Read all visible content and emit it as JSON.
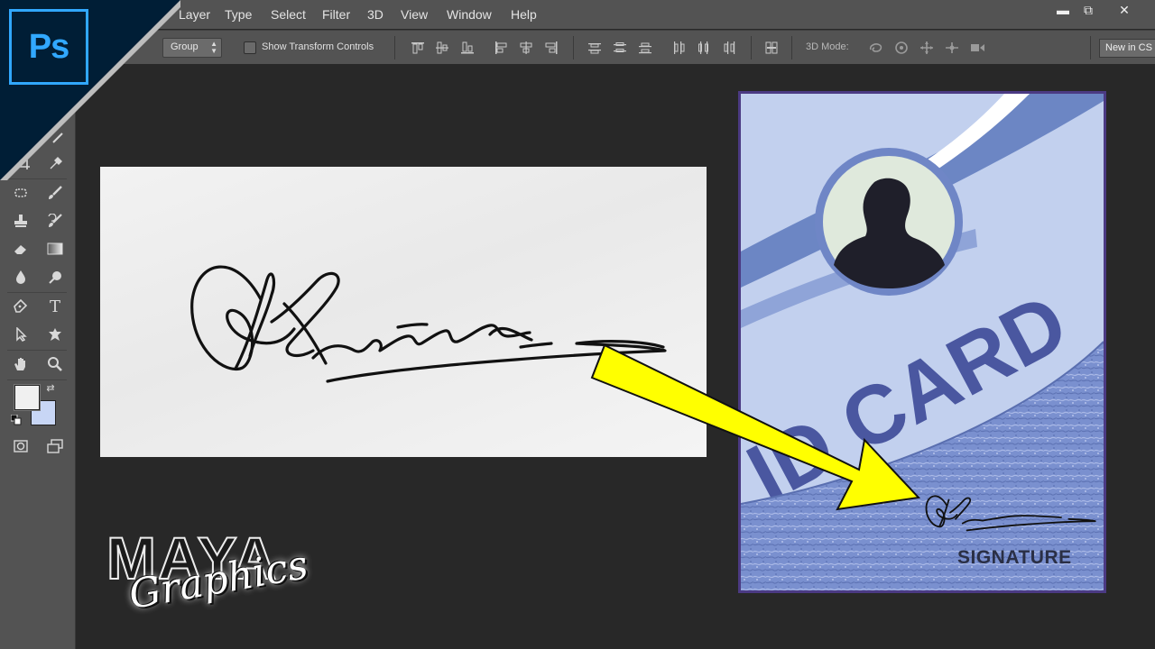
{
  "app": {
    "logo_text": "Ps"
  },
  "menu": {
    "items": [
      "Layer",
      "Type",
      "Select",
      "Filter",
      "3D",
      "View",
      "Window",
      "Help"
    ]
  },
  "window_controls": {
    "minimize": "▬",
    "restore": "⧉",
    "close": "✕"
  },
  "options_bar": {
    "auto_select_value": "Group",
    "show_transform_label": "Show Transform Controls",
    "show_transform_checked": false,
    "mode_3d_label": "3D Mode:",
    "new_button_label": "New in CS"
  },
  "toolbar": {
    "type_tool_glyph": "T",
    "foreground_color": "#f0f0f0",
    "background_color": "#c8d6f5"
  },
  "canvas": {
    "id_card": {
      "headline": "ID CARD",
      "signature_caption": "SIGNATURE",
      "card_color": "#c2d0ee",
      "band_color": "#6c86c4",
      "text_color": "#4a57a0"
    },
    "arrow_color": "#ffff00"
  },
  "watermark": {
    "brand": "MAYA",
    "sub": "Graphics"
  }
}
